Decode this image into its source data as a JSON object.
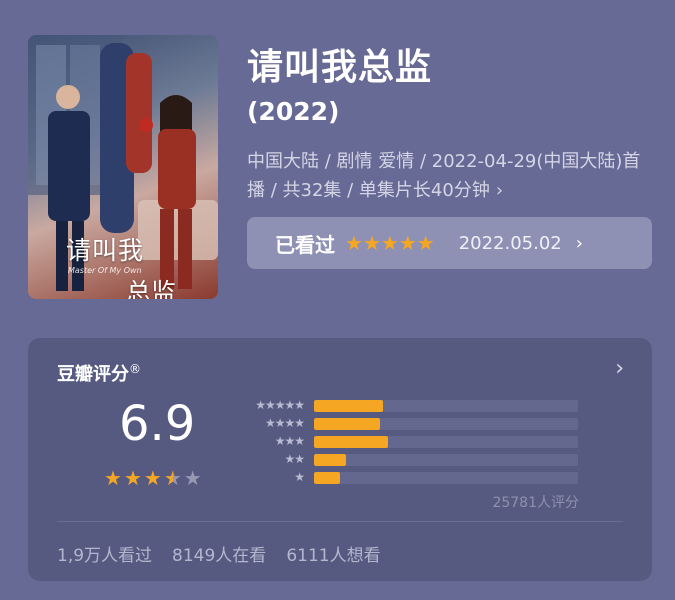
{
  "poster": {
    "title_line1": "请叫我",
    "title_line2": "总监",
    "subtitle": "Master Of My Own"
  },
  "header": {
    "title": "请叫我总监",
    "year": "(2022)",
    "meta": "中国大陆 / 剧情 爱情 / 2022-04-29(中国大陆)首播 / 共32集 / 单集片长40分钟",
    "meta_chevron": "›"
  },
  "watched": {
    "label": "已看过",
    "stars": 5,
    "date": "2022.05.02",
    "chevron": "›"
  },
  "rating": {
    "title": "豆瓣评分",
    "registered_mark": "®",
    "chevron": "›",
    "score": "6.9",
    "star_level": 3.5,
    "distribution": [
      {
        "stars": "★★★★★",
        "percent": 26
      },
      {
        "stars": "★★★★",
        "percent": 25
      },
      {
        "stars": "★★★",
        "percent": 28
      },
      {
        "stars": "★★",
        "percent": 12
      },
      {
        "stars": "★",
        "percent": 10
      }
    ],
    "count": "25781人评分",
    "stats": {
      "watched": "1,9万人看过",
      "watching": "8149人在看",
      "want": "6111人想看"
    }
  },
  "colors": {
    "background": "#676a94",
    "card": "#575a80",
    "accent_star": "#f5a623",
    "pill": "#8f91b4"
  }
}
